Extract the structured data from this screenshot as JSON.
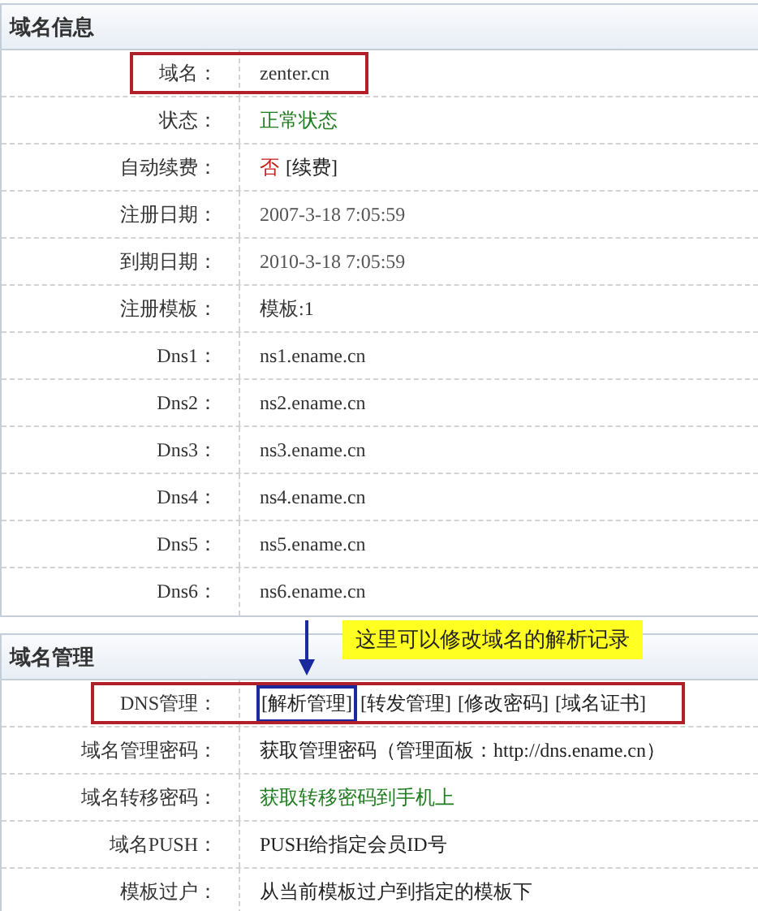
{
  "sections": [
    {
      "title": "域名信息",
      "rows": [
        {
          "label": "域名：",
          "highlighted": true,
          "value": [
            {
              "text": "zenter.cn",
              "kind": "plain",
              "boxed": false
            }
          ]
        },
        {
          "label": "状态：",
          "highlighted": false,
          "value": [
            {
              "text": "正常状态",
              "kind": "green",
              "boxed": false
            }
          ]
        },
        {
          "label": "自动续费：",
          "highlighted": false,
          "value": [
            {
              "text": "否",
              "kind": "red",
              "boxed": false
            },
            {
              "text": "[续费]",
              "kind": "link",
              "boxed": false
            }
          ]
        },
        {
          "label": "注册日期：",
          "highlighted": false,
          "value": [
            {
              "text": "2007-3-18 7:05:59",
              "kind": "muted",
              "boxed": false
            }
          ]
        },
        {
          "label": "到期日期：",
          "highlighted": false,
          "value": [
            {
              "text": "2010-3-18 7:05:59",
              "kind": "muted",
              "boxed": false
            }
          ]
        },
        {
          "label": "注册模板：",
          "highlighted": false,
          "value": [
            {
              "text": "模板:1",
              "kind": "plain",
              "boxed": false
            }
          ]
        },
        {
          "label": "Dns1：",
          "highlighted": false,
          "value": [
            {
              "text": "ns1.ename.cn",
              "kind": "plain",
              "boxed": false
            }
          ]
        },
        {
          "label": "Dns2：",
          "highlighted": false,
          "value": [
            {
              "text": "ns2.ename.cn",
              "kind": "plain",
              "boxed": false
            }
          ]
        },
        {
          "label": "Dns3：",
          "highlighted": false,
          "value": [
            {
              "text": "ns3.ename.cn",
              "kind": "plain",
              "boxed": false
            }
          ]
        },
        {
          "label": "Dns4：",
          "highlighted": false,
          "value": [
            {
              "text": "ns4.ename.cn",
              "kind": "plain",
              "boxed": false
            }
          ]
        },
        {
          "label": "Dns5：",
          "highlighted": false,
          "value": [
            {
              "text": "ns5.ename.cn",
              "kind": "plain",
              "boxed": false
            }
          ]
        },
        {
          "label": "Dns6：",
          "highlighted": false,
          "value": [
            {
              "text": "ns6.ename.cn",
              "kind": "plain",
              "boxed": false
            }
          ]
        }
      ]
    },
    {
      "title": "域名管理",
      "callout": "这里可以修改域名的解析记录",
      "rows": [
        {
          "label": "DNS管理：",
          "highlighted": true,
          "value": [
            {
              "text": "[解析管理]",
              "kind": "link",
              "boxed": true
            },
            {
              "text": "[转发管理]",
              "kind": "link",
              "boxed": false
            },
            {
              "text": "[修改密码]",
              "kind": "link",
              "boxed": false
            },
            {
              "text": "[域名证书]",
              "kind": "link",
              "boxed": false
            }
          ]
        },
        {
          "label": "域名管理密码：",
          "highlighted": false,
          "value": [
            {
              "text": "获取管理密码（管理面板：http://dns.ename.cn）",
              "kind": "link",
              "boxed": false
            }
          ]
        },
        {
          "label": "域名转移密码：",
          "highlighted": false,
          "value": [
            {
              "text": "获取转移密码到手机上",
              "kind": "greenlink",
              "boxed": false
            }
          ]
        },
        {
          "label": "域名PUSH：",
          "highlighted": false,
          "value": [
            {
              "text": "PUSH给指定会员ID号",
              "kind": "link",
              "boxed": false
            }
          ]
        },
        {
          "label": "模板过户：",
          "highlighted": false,
          "value": [
            {
              "text": "从当前模板过户到指定的模板下",
              "kind": "link",
              "boxed": false
            }
          ]
        }
      ]
    }
  ]
}
